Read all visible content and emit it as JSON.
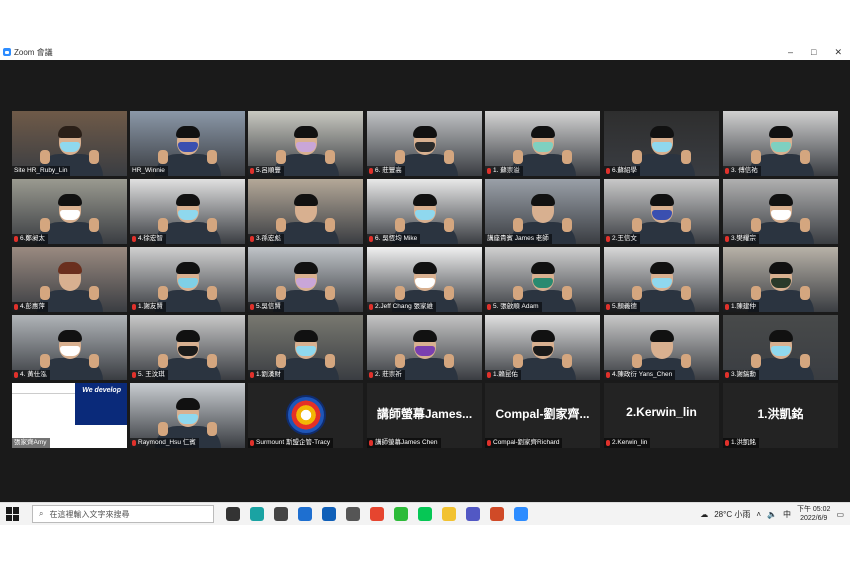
{
  "window": {
    "title": "Zoom 會議",
    "controls": [
      "–",
      "□",
      "✕"
    ]
  },
  "participants": [
    {
      "name": "Site HR_Ruby_Lin",
      "mask": "#8fd8ee",
      "bg": "#6f5a48",
      "hair": "#2a1f18",
      "muted": false
    },
    {
      "name": "HR_Winnie",
      "mask": "#3a4fb0",
      "bg": "#8b98a8",
      "hair": "#111111",
      "muted": false
    },
    {
      "name": "5.呂順豐",
      "mask": "#c9a6d8",
      "bg": "#c8c8c0",
      "hair": "#111111",
      "muted": true
    },
    {
      "name": "6. 莊豐高",
      "mask": "#2a2a2a",
      "bg": "#c0c2c4",
      "hair": "#111111",
      "muted": true
    },
    {
      "name": "1. 蘇崇溢",
      "mask": "#7fd0c0",
      "bg": "#d4d4d4",
      "hair": "#111111",
      "muted": true
    },
    {
      "name": "6.蘇紹學",
      "mask": "#8fd8ee",
      "bg": "#2e2e2e",
      "hair": "#111111",
      "muted": true
    },
    {
      "name": "3. 傅信祐",
      "mask": "#7fd0c0",
      "bg": "#d0d0d0",
      "hair": "#111111",
      "muted": true
    },
    {
      "name": "6.鄭昶太",
      "mask": "#ffffff",
      "bg": "#9a9a90",
      "hair": "#111111",
      "muted": true
    },
    {
      "name": "4.徐宏智",
      "mask": "#8fd8ee",
      "bg": "#e0e0e0",
      "hair": "#111111",
      "muted": true
    },
    {
      "name": "3.孫宏彪",
      "mask": "none",
      "bg": "#b4a898",
      "hair": "#111111",
      "muted": true
    },
    {
      "name": "6. 吳恆均 Mike",
      "mask": "#8fd8ee",
      "bg": "#e8e8e8",
      "hair": "#111111",
      "muted": true
    },
    {
      "name": "講座貴賓 James 老師",
      "mask": "none",
      "bg": "#9aa0a8",
      "hair": "#111111",
      "muted": false
    },
    {
      "name": "2.王信文",
      "mask": "#3a4fb0",
      "bg": "#c8c8c8",
      "hair": "#111111",
      "muted": true
    },
    {
      "name": "3.樊耀宗",
      "mask": "#ffffff",
      "bg": "#b0b0b0",
      "hair": "#111111",
      "muted": true
    },
    {
      "name": "4.彭惠萍",
      "mask": "none",
      "bg": "#9a8a80",
      "hair": "#6a2f1e",
      "muted": true
    },
    {
      "name": "1.謝友賢",
      "mask": "#7fd0e6",
      "bg": "#d0d0d0",
      "hair": "#111111",
      "muted": true
    },
    {
      "name": "5.吳信賢",
      "mask": "#c9a6d8",
      "bg": "#c0c4c8",
      "hair": "#111111",
      "muted": true
    },
    {
      "name": "2.Jeff Chang 張家維",
      "mask": "#ffffff",
      "bg": "#f0f0f0",
      "hair": "#111111",
      "muted": true
    },
    {
      "name": "5. 張啟順 Adam",
      "mask": "#2a8a70",
      "bg": "#d0d0d0",
      "hair": "#111111",
      "muted": true
    },
    {
      "name": "5.顏義德",
      "mask": "#8fd8ee",
      "bg": "#d8d8d8",
      "hair": "#111111",
      "muted": true
    },
    {
      "name": "1.陳建仲",
      "mask": "#2a3a2a",
      "bg": "#b8b2a8",
      "hair": "#111111",
      "muted": true
    },
    {
      "name": "4. 黃仕泓",
      "mask": "#ffffff",
      "bg": "#b0b4b8",
      "hair": "#111111",
      "muted": true
    },
    {
      "name": "5. 王汶琪",
      "mask": "#1a1a1a",
      "bg": "#c8c8c8",
      "hair": "#111111",
      "muted": true
    },
    {
      "name": "1.劉漢財",
      "mask": "#8fd8ee",
      "bg": "#787870",
      "hair": "#111111",
      "muted": true
    },
    {
      "name": "2. 莊崇祈",
      "mask": "#7a3fb0",
      "bg": "#c4c4c4",
      "hair": "#111111",
      "muted": true
    },
    {
      "name": "1.賴昆佑",
      "mask": "#1a1a1a",
      "bg": "#e0e0e0",
      "hair": "#111111",
      "muted": true
    },
    {
      "name": "4.陳政衍 Yans_Chen",
      "mask": "none",
      "bg": "#c8c8c8",
      "hair": "#111111",
      "muted": true
    },
    {
      "name": "3.謝鎬勳",
      "mask": "#8fd8ee",
      "bg": "#484a4a",
      "hair": "#111111",
      "muted": true
    },
    {
      "name": "張家齊Amy",
      "type": "screen",
      "muted": false
    },
    {
      "name": "Raymond_Hsu 仁賓",
      "mask": "#8fd8ee",
      "bg": "#c8ccd0",
      "hair": "#111111",
      "muted": true
    },
    {
      "name": "Surmount 斯盟企管-Tracy",
      "type": "logo",
      "muted": true
    },
    {
      "name": "講師螢幕James Chen",
      "type": "nv",
      "big": "講師螢幕James...",
      "muted": true
    },
    {
      "name": "Compal-劉家齊Richard",
      "type": "nv",
      "big": "Compal-劉家齊...",
      "muted": true
    },
    {
      "name": "2.Kerwin_lin",
      "type": "nv",
      "big": "2.Kerwin_lin",
      "muted": true
    },
    {
      "name": "1.洪凱銘",
      "type": "nv",
      "big": "1.洪凱銘",
      "muted": true
    }
  ],
  "screen_share": {
    "banner": "We develop"
  },
  "taskbar": {
    "search_placeholder": "在這裡輸入文字來搜尋",
    "weather": "28°C 小雨",
    "ime": "中",
    "time": "下午 05:02",
    "date": "2022/6/9",
    "icons": [
      {
        "name": "task-view-icon",
        "color": "#333333"
      },
      {
        "name": "edge-icon",
        "color": "#1aa3a3"
      },
      {
        "name": "mail-icon",
        "color": "#444444"
      },
      {
        "name": "ie-icon",
        "color": "#1e6fd0"
      },
      {
        "name": "outlook-icon",
        "color": "#0f5fb8"
      },
      {
        "name": "app-icon",
        "color": "#555555"
      },
      {
        "name": "chrome-icon",
        "color": "#e6452f"
      },
      {
        "name": "wechat-icon",
        "color": "#2dbb39"
      },
      {
        "name": "line-icon",
        "color": "#06c755"
      },
      {
        "name": "folder-icon",
        "color": "#f2c230"
      },
      {
        "name": "teams-icon",
        "color": "#5258c4"
      },
      {
        "name": "powerpoint-icon",
        "color": "#d04a27"
      },
      {
        "name": "zoom-icon",
        "color": "#2d8cff"
      }
    ]
  }
}
